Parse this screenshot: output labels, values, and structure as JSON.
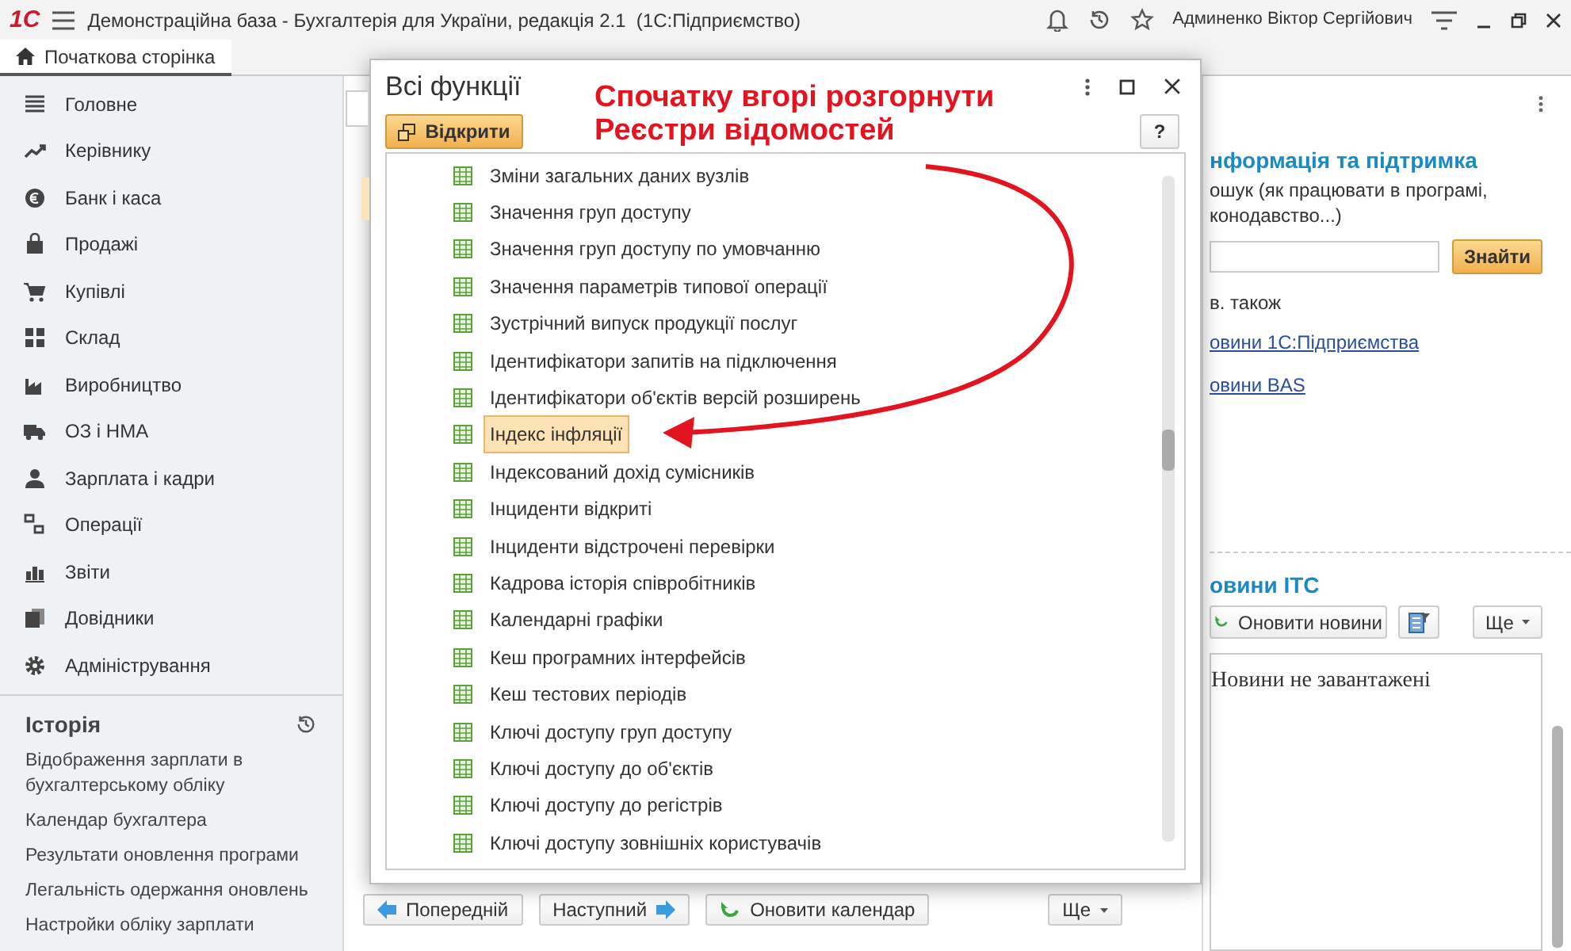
{
  "title_bar": {
    "logo": "1С",
    "title": "Демонстраційна база - Бухгалтерія для України, редакція 2.1  (1С:Підприємство)",
    "user": "Админенко Віктор Сергійович"
  },
  "tabs": [
    {
      "label": "Початкова сторінка",
      "selected": true
    }
  ],
  "sidebar": {
    "items": [
      "Головне",
      "Керівнику",
      "Банк і каса",
      "Продажі",
      "Купівлі",
      "Склад",
      "Виробництво",
      "ОЗ і НМА",
      "Зарплата і кадри",
      "Операції",
      "Звіти",
      "Довідники",
      "Адміністрування"
    ]
  },
  "history": {
    "title": "Історія",
    "items": [
      "Відображення зарплати в бухгалтерському обліку",
      "Календар бухгалтера",
      "Результати оновлення програми",
      "Легальність одержання оновлень",
      "Настройки обліку зарплати"
    ]
  },
  "background_page": {
    "buttons": [
      "Попередній",
      "Наступний",
      "Оновити календар",
      "Ще"
    ]
  },
  "right_panel": {
    "heading": "нформація та підтримка",
    "hint_lines": [
      "ошук (як працювати в програмі,",
      "конодавство...)"
    ],
    "search_button": "Знайти",
    "see_also": "в. також",
    "links": [
      "овини 1С:Підприємства",
      "овини BAS"
    ],
    "news_heading": "овини ІТС",
    "refresh_button": "Оновити новини",
    "more_button": "Ще",
    "news_text": "Новини не завантажені"
  },
  "dialog": {
    "title": "Всі функції",
    "open_button": "Відкрити",
    "help_button": "?",
    "items": [
      {
        "label": "Зміни загальних даних вузлів",
        "selected": false
      },
      {
        "label": "Значення груп доступу",
        "selected": false
      },
      {
        "label": "Значення груп доступу по умовчанню",
        "selected": false
      },
      {
        "label": "Значення параметрів типової операції",
        "selected": false
      },
      {
        "label": "Зустрічний випуск продукції послуг",
        "selected": false
      },
      {
        "label": "Ідентифікатори запитів на підключення",
        "selected": false
      },
      {
        "label": "Ідентифікатори об'єктів версій розширень",
        "selected": false
      },
      {
        "label": "Індекс інфляції",
        "selected": true
      },
      {
        "label": "Індексований дохід сумісників",
        "selected": false
      },
      {
        "label": "Інциденти відкриті",
        "selected": false
      },
      {
        "label": "Інциденти відстрочені перевірки",
        "selected": false
      },
      {
        "label": "Кадрова історія співробітників",
        "selected": false
      },
      {
        "label": "Календарні графіки",
        "selected": false
      },
      {
        "label": "Кеш програмних інтерфейсів",
        "selected": false
      },
      {
        "label": "Кеш тестових періодів",
        "selected": false
      },
      {
        "label": "Ключі доступу груп доступу",
        "selected": false
      },
      {
        "label": "Ключі доступу до об'єктів",
        "selected": false
      },
      {
        "label": "Ключі доступу до регістрів",
        "selected": false
      },
      {
        "label": "Ключі доступу зовнішніх користувачів",
        "selected": false
      }
    ]
  },
  "annotation": {
    "lines": [
      "Спочатку вгорі розгорнути",
      "Реєстри відомостей"
    ]
  }
}
